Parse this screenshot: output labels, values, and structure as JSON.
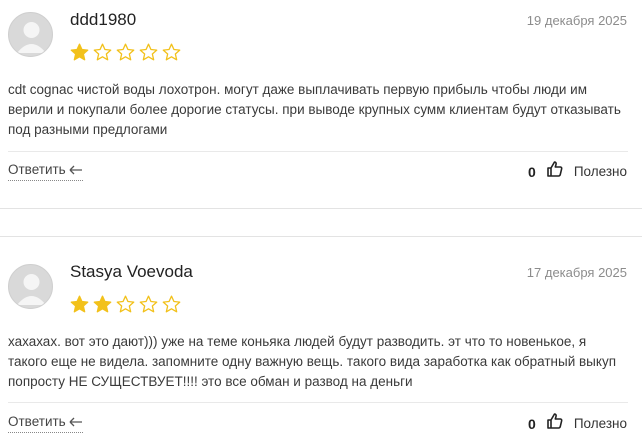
{
  "reviews": [
    {
      "author": "ddd1980",
      "date": "19 декабря 2025",
      "rating": 1,
      "max_rating": 5,
      "text": "cdt cognac чистой воды лохотрон. могут даже выплачивать первую прибыль чтобы люди им верили и покупали более дорогие статусы. при выводе крупных сумм клиентам будут отказывать под разными предлогами",
      "reply_label": "Ответить",
      "useful_count": "0",
      "useful_label": "Полезно"
    },
    {
      "author": "Stasya Voevoda",
      "date": "17 декабря 2025",
      "rating": 2,
      "max_rating": 5,
      "text": "хахахах. вот это дают))) уже на теме коньяка людей будут разводить. эт что то новенькое, я такого еще не видела. запомните одну важную вещь. такого вида заработка как обратный выкуп попросту НЕ СУЩЕСТВУЕТ!!!! это все обман и развод на деньги",
      "reply_label": "Ответить",
      "useful_count": "0",
      "useful_label": "Полезно"
    }
  ],
  "colors": {
    "star_filled": "#f2c11b",
    "star_empty_stroke": "#f2c11b"
  },
  "icons": {
    "avatar": "user-avatar-icon",
    "star": "star-icon",
    "reply": "reply-arrow-icon",
    "like": "thumbs-up-icon"
  }
}
